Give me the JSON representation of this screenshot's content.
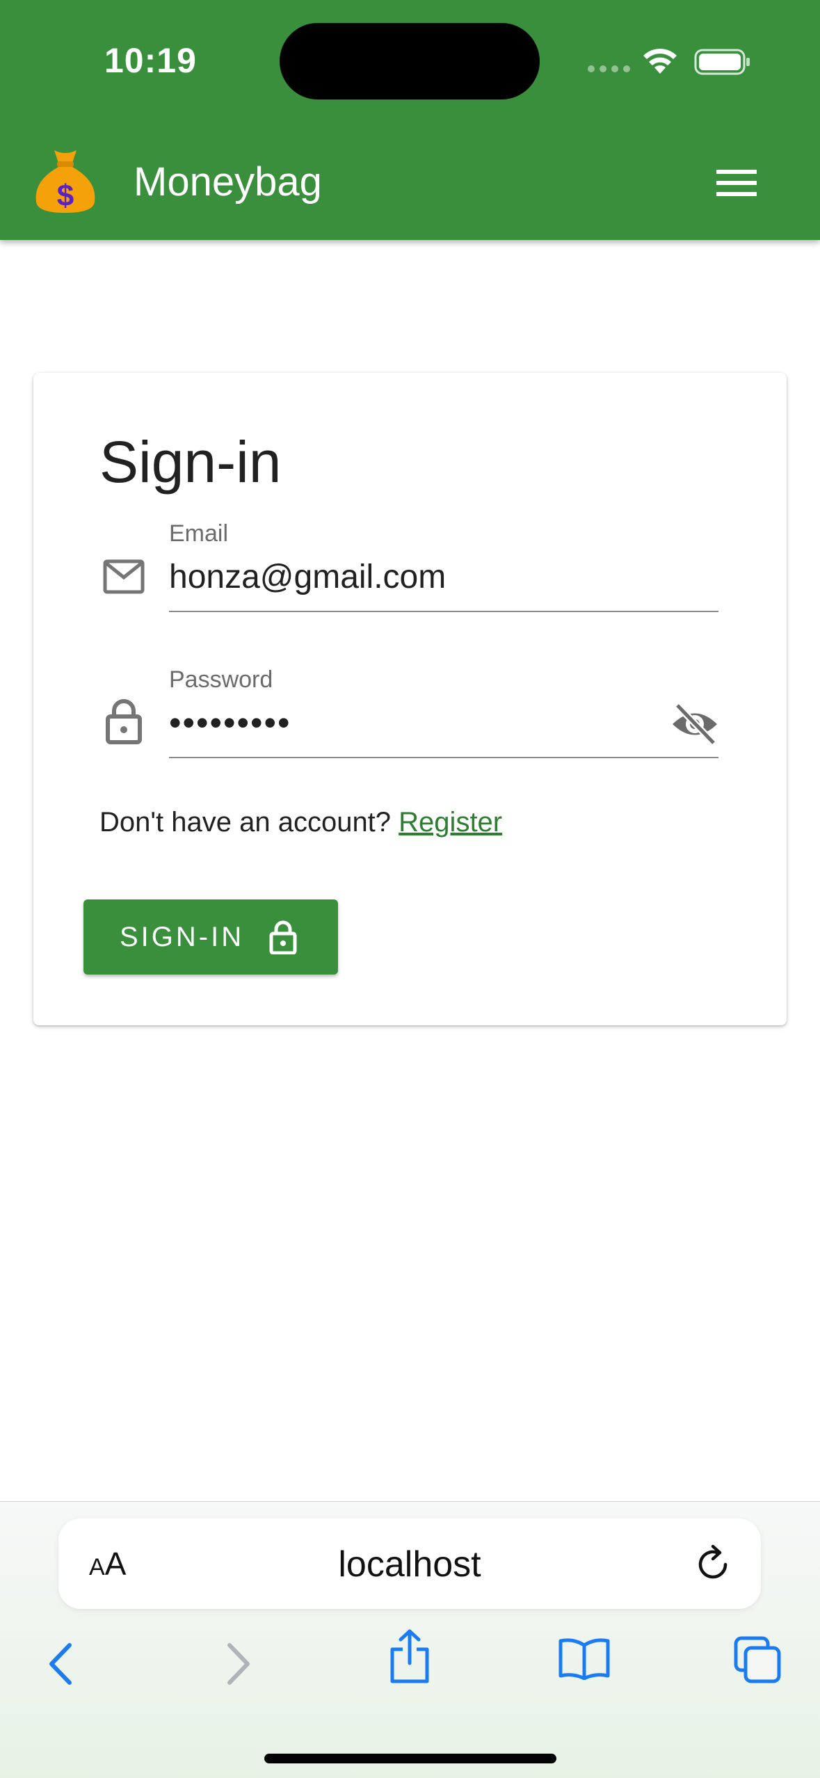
{
  "status_bar": {
    "time": "10:19"
  },
  "app_bar": {
    "title": "Moneybag",
    "logo_icon": "money-bag-icon",
    "menu_icon": "hamburger-menu-icon",
    "color": "#3a8f3d"
  },
  "signin_card": {
    "title": "Sign-in",
    "email": {
      "label": "Email",
      "value": "honza@gmail.com",
      "icon": "mail-icon"
    },
    "password": {
      "label": "Password",
      "value": "•••••••••",
      "icon": "lock-icon",
      "visibility_icon": "eye-off-icon"
    },
    "register_prompt": "Don't have an account?",
    "register_link": "Register",
    "submit_label": "SIGN-IN",
    "submit_icon": "lock-icon"
  },
  "browser": {
    "text_size_button": "AA",
    "url": "localhost",
    "reload_icon": "reload-icon",
    "toolbar_icons": [
      "back-icon",
      "forward-icon",
      "share-icon",
      "bookmarks-icon",
      "tabs-icon"
    ]
  },
  "colors": {
    "accent": "#3a8f3d",
    "link": "#2e7d32",
    "safari_blue": "#1b7cf2"
  }
}
